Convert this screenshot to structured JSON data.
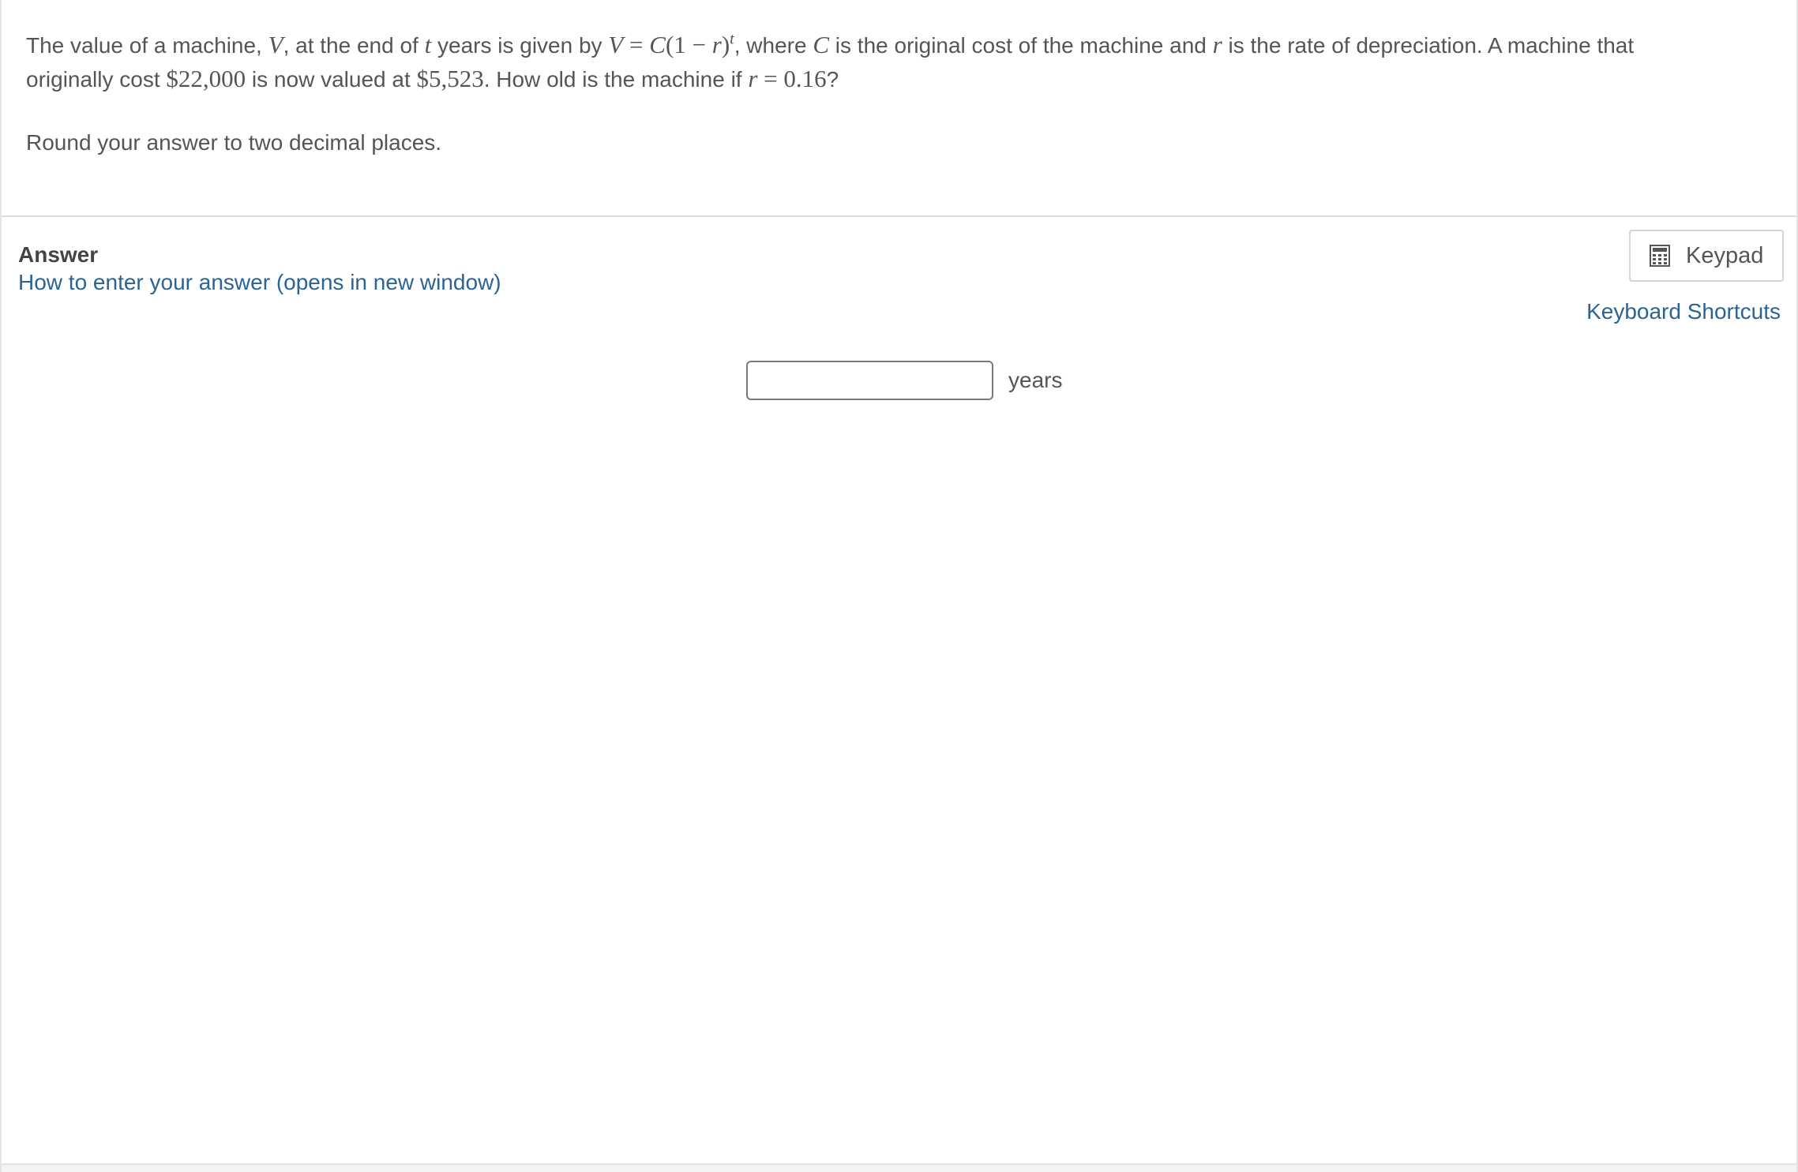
{
  "question": {
    "line1": {
      "t1": "The value of a machine, ",
      "var_V": "V",
      "t2": ", at the end of ",
      "var_t": "t",
      "t3": " years is given by ",
      "formula_lhs": "V",
      "formula_eq": " = ",
      "formula_C": "C",
      "formula_paren": "(1 − ",
      "formula_r": "r",
      "formula_close": ")",
      "formula_exp": "t",
      "t4": ", where ",
      "var_C": "C",
      "t5": " is the original cost of the machine and ",
      "var_r": "r",
      "t6": " is the rate of depreciation.  A machine that"
    },
    "line2": {
      "t1": "originally cost ",
      "cost": "$22,000",
      "t2": " is now valued at ",
      "value": "$5,523",
      "t3": ".  How old is the machine if ",
      "rate_var": "r",
      "rate_eq": " = 0.16",
      "t4": "?"
    },
    "instruction": "Round your answer to two decimal places."
  },
  "answer": {
    "title": "Answer",
    "help_link": "How to enter your answer (opens in new window)",
    "keypad_label": "Keypad",
    "keypad_icon": "calculator-icon",
    "shortcuts_link": "Keyboard Shortcuts",
    "input_value": "",
    "input_placeholder": "",
    "unit": "years"
  }
}
